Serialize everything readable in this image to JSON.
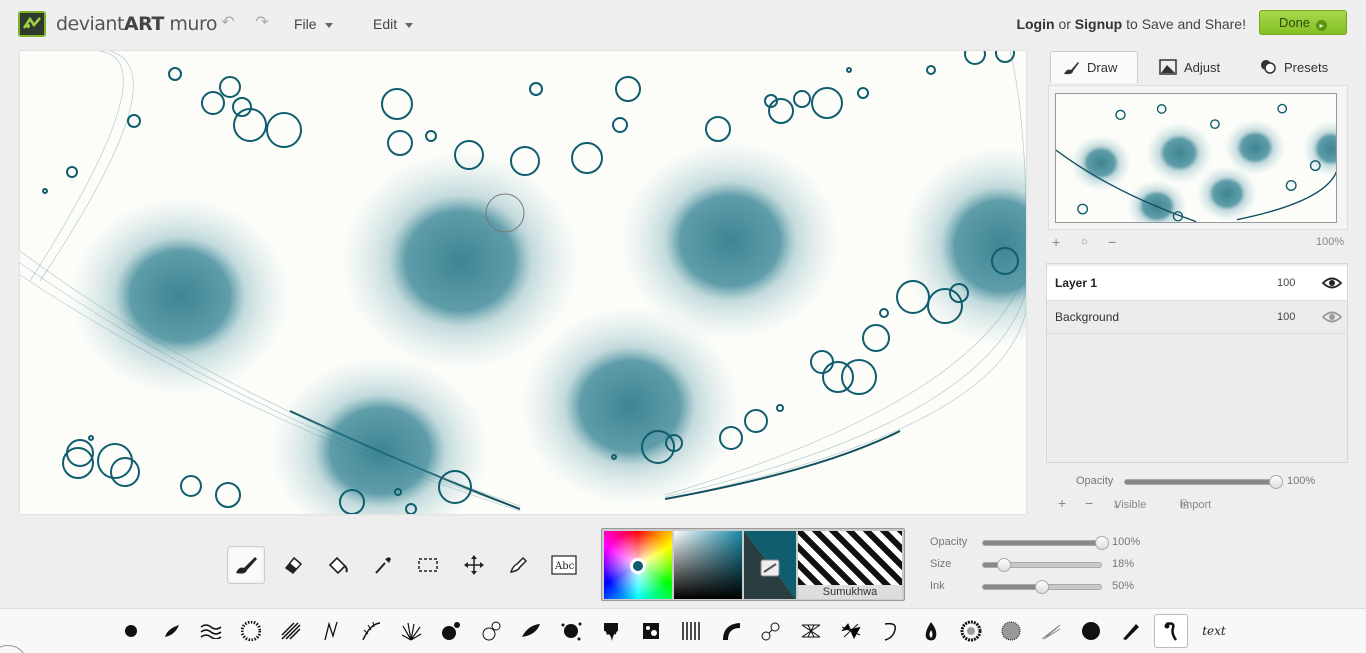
{
  "app": {
    "logo_text_light": "deviant",
    "logo_text_bold": "ART",
    "logo_text_suffix": " muro"
  },
  "menu": {
    "file_label": "File",
    "edit_label": "Edit"
  },
  "account": {
    "login": "Login",
    "or": " or ",
    "signup": "Signup",
    "suffix": " to Save and Share!"
  },
  "done_label": "Done",
  "tabs": [
    {
      "label": "Draw"
    },
    {
      "label": "Adjust"
    },
    {
      "label": "Presets"
    }
  ],
  "preview": {
    "zoom": "100%"
  },
  "layers": [
    {
      "name": "Layer 1",
      "opacity": "100",
      "selected": true
    },
    {
      "name": "Background",
      "opacity": "100",
      "selected": false
    }
  ],
  "layer_opacity": {
    "label": "Opacity",
    "value": "100%",
    "fraction": 1.0
  },
  "layer_controls": {
    "visible": "Visible",
    "import": "Import"
  },
  "color": {
    "current": "#0f5d6e",
    "texture_label": "Sumukhwa"
  },
  "brush_settings": [
    {
      "label": "Opacity",
      "value": "100%",
      "fraction": 1.0
    },
    {
      "label": "Size",
      "value": "18%",
      "fraction": 0.18
    },
    {
      "label": "Ink",
      "value": "50%",
      "fraction": 0.5
    }
  ],
  "tools": [
    "brush-tool",
    "eraser-tool",
    "fill-tool",
    "eyedropper-tool",
    "select-tool",
    "move-tool",
    "smudge-tool",
    "text-tool"
  ],
  "brushes_text_label": "text",
  "theme": {
    "accent": "#8cc63f",
    "ink": "#0f5d6e"
  }
}
